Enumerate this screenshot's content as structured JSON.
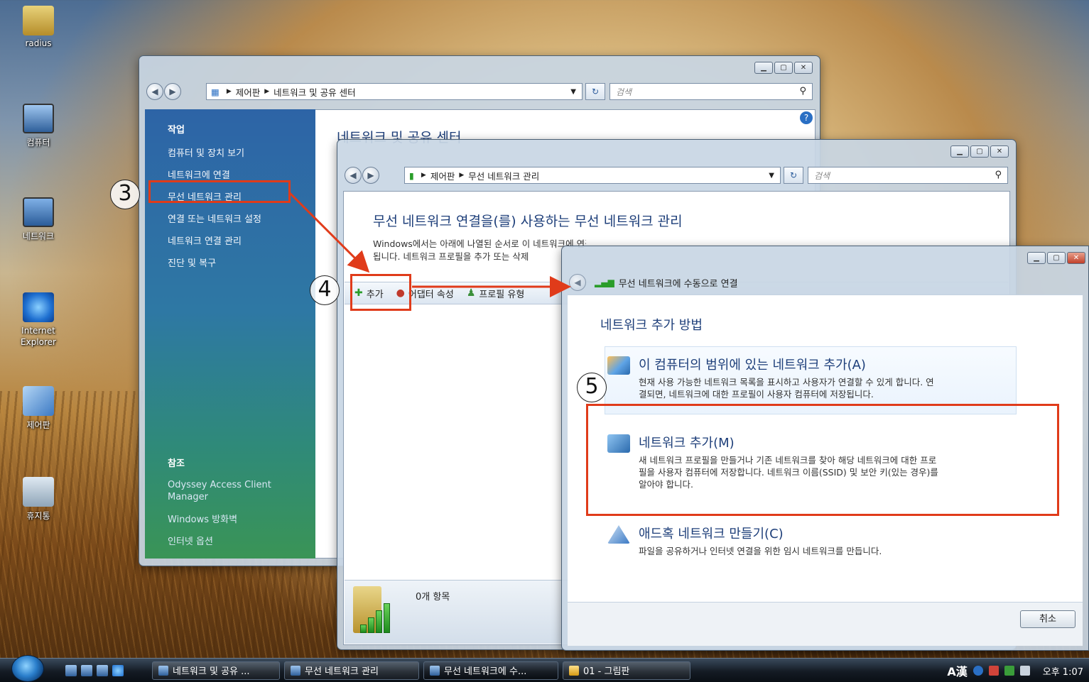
{
  "desktop": {
    "icons": [
      {
        "label": "radius",
        "icon": "folder-icon"
      },
      {
        "label": "컴퓨터",
        "icon": "computer-icon"
      },
      {
        "label": "네트워크",
        "icon": "network-icon"
      },
      {
        "label": "Internet Explorer",
        "icon": "ie-icon"
      },
      {
        "label": "제어판",
        "icon": "control-panel-icon"
      },
      {
        "label": "휴지통",
        "icon": "recycle-bin-icon"
      }
    ]
  },
  "window1": {
    "breadcrumb": [
      "제어판",
      "네트워크 및 공유 센터"
    ],
    "search_placeholder": "검색",
    "page_title": "네트워크 및 공유 센터",
    "tasks_header": "작업",
    "tasks": [
      "컴퓨터 및 장치 보기",
      "네트워크에 연결",
      "무선 네트워크 관리",
      "연결 또는 네트워크 설정",
      "네트워크 연결 관리",
      "진단 및 복구"
    ],
    "see_also_header": "참조",
    "see_also": [
      "Odyssey Access Client Manager",
      "Windows 방화벽",
      "인터넷 옵션"
    ]
  },
  "window2": {
    "breadcrumb": [
      "제어판",
      "무선 네트워크 관리"
    ],
    "search_placeholder": "검색",
    "title": "무선 네트워크 연결을(를) 사용하는 무선 네트워크 관리",
    "description_line1": "Windows에서는 아래에 나열된 순서로 이 네트워크에 연결을 시도합니다. 순서를 변경하려면 목록에서 네트워크를 위나 아래로 끌면",
    "description_line2": "됩니다. 네트워크 프로필을 추가 또는 삭제",
    "toolbar": {
      "add": "추가",
      "adapter": "어댑터 속성",
      "profile_types": "프로필 유형"
    },
    "item_count": "0개 항목"
  },
  "window3": {
    "title": "무선 네트워크에 수동으로 연결",
    "heading": "네트워크 추가 방법",
    "options": [
      {
        "title": "이 컴퓨터의 범위에 있는 네트워크 추가(A)",
        "desc1": "현재 사용 가능한 네트워크 목록을 표시하고 사용자가 연결할 수 있게 합니다. 연",
        "desc2": "결되면, 네트워크에 대한 프로필이 사용자 컴퓨터에 저장됩니다."
      },
      {
        "title": "네트워크 추가(M)",
        "desc1": "새 네트워크 프로필을 만들거나 기존 네트워크를 찾아 해당 네트워크에 대한 프로",
        "desc2": "필을 사용자 컴퓨터에 저장합니다. 네트워크 이름(SSID) 및 보안 키(있는 경우)를",
        "desc3": "알아야 합니다."
      },
      {
        "title": "애드혹 네트워크 만들기(C)",
        "desc1": "파일을 공유하거나 인터넷 연결을 위한 임시 네트워크를 만듭니다."
      }
    ],
    "cancel": "취소"
  },
  "annotations": {
    "step3": "3",
    "step4": "4",
    "step5": "5",
    "color": "#e03b1a"
  },
  "taskbar": {
    "buttons": [
      "네트워크 및 공유 ...",
      "무선 네트워크 관리",
      "무선 네트워크에 수...",
      "01 - 그림판"
    ],
    "ime": "A漢",
    "clock": "오후 1:07"
  }
}
